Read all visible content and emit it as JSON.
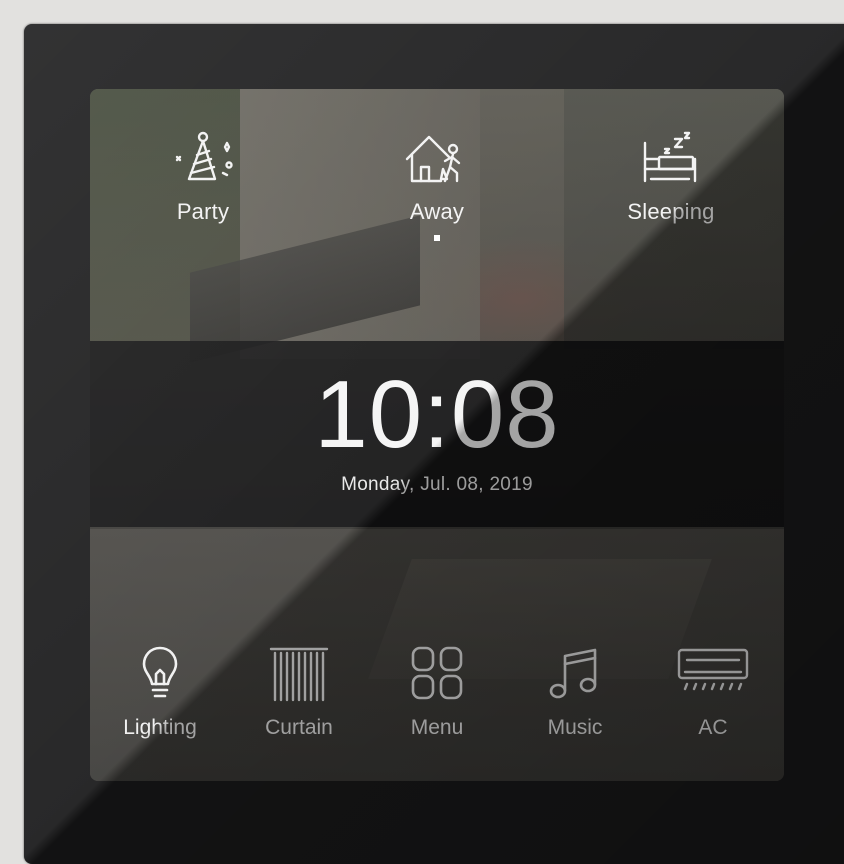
{
  "scenes": [
    {
      "label": "Party",
      "icon": "party-hat-icon"
    },
    {
      "label": "Away",
      "icon": "house-walking-person-icon"
    },
    {
      "label": "Sleeping",
      "icon": "bed-sleep-icon"
    }
  ],
  "active_scene": "Away",
  "clock": {
    "time": "10:08",
    "date": "Monday, Jul. 08, 2019"
  },
  "dock": [
    {
      "label": "Lighting",
      "icon": "lightbulb-icon"
    },
    {
      "label": "Curtain",
      "icon": "curtain-icon"
    },
    {
      "label": "Menu",
      "icon": "menu-grid-icon"
    },
    {
      "label": "Music",
      "icon": "music-note-icon"
    },
    {
      "label": "AC",
      "icon": "air-conditioner-icon"
    }
  ],
  "colors": {
    "bezel": "#1b1b1c",
    "text": "#f2f2f2",
    "clock_band": "#121213"
  }
}
